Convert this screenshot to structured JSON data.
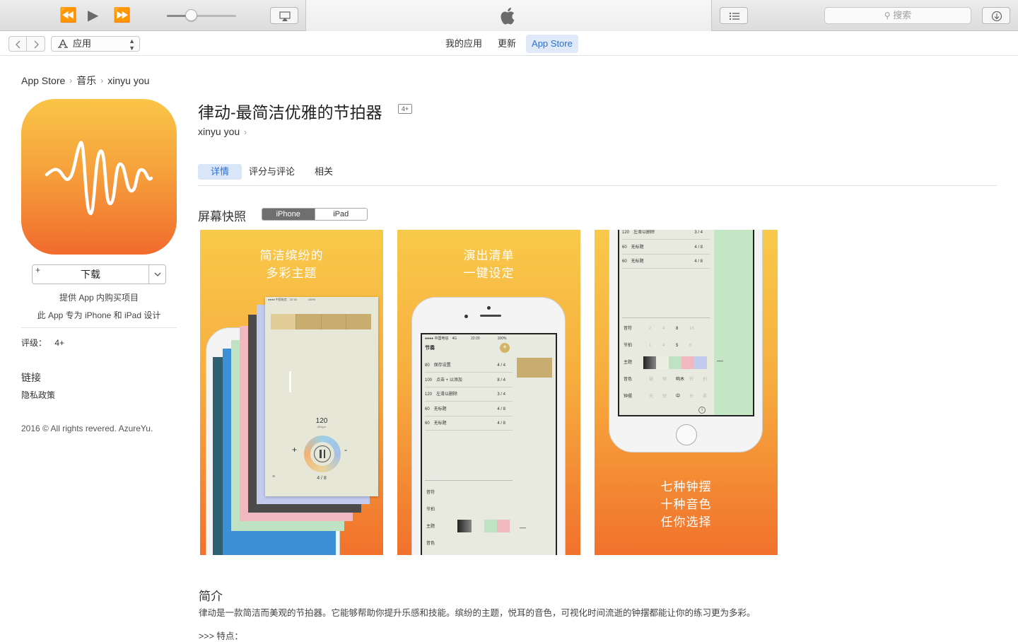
{
  "toolbar": {
    "search_placeholder": "搜索",
    "volume_level": 0.35
  },
  "navbar": {
    "media_selector": "应用",
    "tabs": [
      {
        "label": "我的应用",
        "active": false
      },
      {
        "label": "更新",
        "active": false
      },
      {
        "label": "App Store",
        "active": true
      }
    ]
  },
  "breadcrumb": [
    "App Store",
    "音乐",
    "xinyu you"
  ],
  "sidebar": {
    "get_label": "下载",
    "iap": "提供 App 内购买项目",
    "designed_for": "此 App 专为 iPhone 和 iPad 设计",
    "rating_label": "评级：",
    "rating_value": "4+",
    "links_heading": "链接",
    "privacy": "隐私政策",
    "copyright": "2016 © All rights revered. AzureYu."
  },
  "app": {
    "title": "律动-最简洁优雅的节拍器",
    "age_badge": "4+",
    "developer": "xinyu you"
  },
  "detail_tabs": [
    {
      "label": "详情",
      "active": true
    },
    {
      "label": "评分与评论",
      "active": false
    },
    {
      "label": "相关",
      "active": false
    }
  ],
  "screenshots": {
    "heading": "屏幕快照",
    "device_tabs": [
      {
        "label": "iPhone",
        "active": true
      },
      {
        "label": "iPad",
        "active": false
      }
    ],
    "items": [
      {
        "caption": [
          "简洁缤纷的",
          "多彩主题"
        ],
        "bpm": "120",
        "bpm_unit": "Allegro",
        "meter": "4 / 8"
      },
      {
        "caption": [
          "演出清单",
          "一键设定"
        ],
        "list_title": "节奏",
        "rows": [
          {
            "tempo": "80",
            "name": "保存设置",
            "meter": "4 / 4"
          },
          {
            "tempo": "100",
            "name": "点击 + 以添加",
            "meter": "8 / 4"
          },
          {
            "tempo": "120",
            "name": "左滑以删除",
            "meter": "3 / 4"
          },
          {
            "tempo": "60",
            "name": "无标题",
            "meter": "4 / 8"
          },
          {
            "tempo": "60",
            "name": "无标题",
            "meter": "4 / 8"
          }
        ]
      },
      {
        "caption": [
          "七种钟摆",
          "十种音色",
          "任你选择"
        ],
        "rows": [
          {
            "tempo": "120",
            "name": "左滑以删除",
            "meter": "3 / 4"
          },
          {
            "tempo": "60",
            "name": "无标题",
            "meter": "4 / 8"
          },
          {
            "tempo": "60",
            "name": "无标题",
            "meter": "4 / 8"
          }
        ],
        "settings": [
          {
            "label": "音符",
            "values": [
              "2",
              "4",
              "8",
              "16"
            ],
            "selected": "8"
          },
          {
            "label": "节拍",
            "values": [
              "1",
              "4",
              "5",
              "6"
            ],
            "selected": "5"
          },
          {
            "label": "主题"
          },
          {
            "label": "音色",
            "values": [
              "鼓",
              "钢",
              "响木",
              "铃",
              "拍"
            ],
            "selected": "响木"
          },
          {
            "label": "钟摆",
            "values": [
              "无",
              "短",
              "中",
              "长",
              "柔"
            ],
            "selected": "中"
          }
        ]
      }
    ]
  },
  "intro": {
    "heading": "简介",
    "body": "律动是一款简洁而美观的节拍器。它能够帮助你提升乐感和技能。缤纷的主题，悦耳的音色，可视化时间流逝的钟摆都能让你的练习更为多彩。",
    "features": ">>> 特点："
  },
  "colors": {
    "accent": "#2c6fd1",
    "icon_top": "#f9c547",
    "icon_bottom": "#f16b2d",
    "tab_active_bg": "#dfe9f7"
  }
}
